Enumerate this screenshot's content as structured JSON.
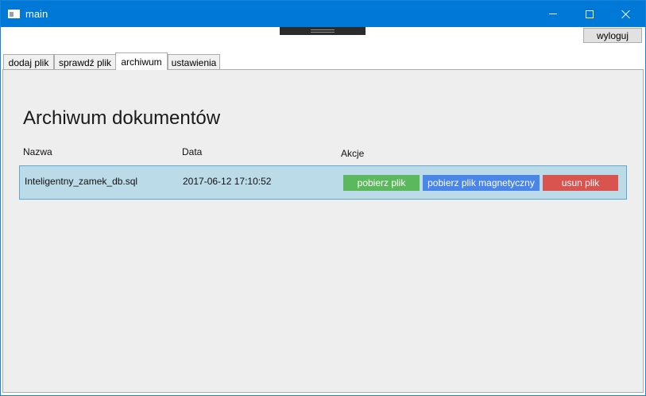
{
  "window": {
    "title": "main"
  },
  "header": {
    "logout_label": "wyloguj"
  },
  "tabs": [
    {
      "label": "dodaj plik"
    },
    {
      "label": "sprawdź plik"
    },
    {
      "label": "archiwum"
    },
    {
      "label": "ustawienia"
    }
  ],
  "archive": {
    "title": "Archiwum dokumentów",
    "columns": {
      "name": "Nazwa",
      "date": "Data",
      "actions": "Akcje"
    },
    "rows": [
      {
        "name": "Inteligentny_zamek_db.sql",
        "date": "2017-06-12 17:10:52",
        "actions": {
          "download": "pobierz plik",
          "download_magnet": "pobierz plik magnetyczny",
          "delete": "usun plik"
        }
      }
    ]
  },
  "colors": {
    "titlebar": "#0078d7",
    "download_button": "#5cb85c",
    "magnet_button": "#4a86e8",
    "delete_button": "#d9534f",
    "row_background": "#bcdbe8"
  }
}
